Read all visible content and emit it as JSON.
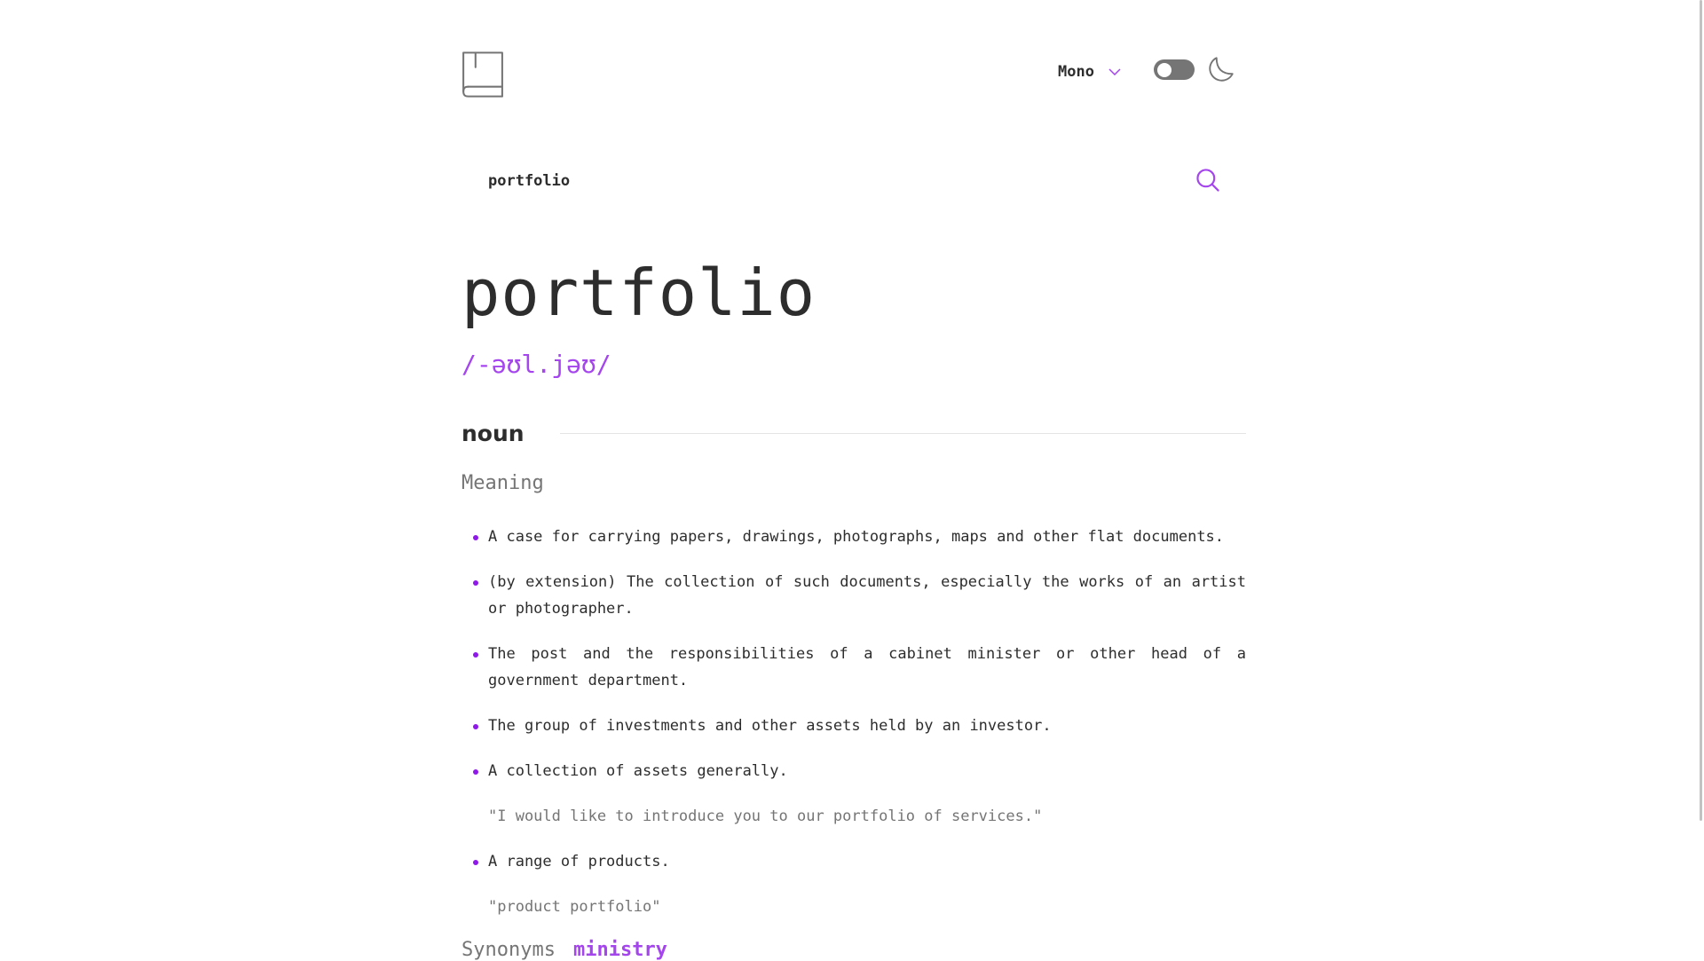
{
  "header": {
    "logo_icon": "book-icon",
    "font_selected": "Mono",
    "font_dropdown_icon": "chevron-down-icon",
    "theme_toggle_state": "off",
    "theme_icon": "moon-icon"
  },
  "search": {
    "value": "portfolio",
    "icon": "search-icon"
  },
  "entry": {
    "word": "portfolio",
    "phonetic": "/-əʊl.jəʊ/",
    "part_of_speech": "noun",
    "meaning_heading": "Meaning",
    "definitions": [
      {
        "text": "A case for carrying papers, drawings, photographs, maps and other flat documents.",
        "example": ""
      },
      {
        "text": "(by extension) The collection of such documents, especially the works of an artist or photographer.",
        "example": ""
      },
      {
        "text": "The post and the responsibilities of a cabinet minister or other head of a government department.",
        "example": ""
      },
      {
        "text": "The group of investments and other assets held by an investor.",
        "example": ""
      },
      {
        "text": "A collection of assets generally.",
        "example": "\"I would like to introduce you to our portfolio of services.\""
      },
      {
        "text": "A range of products.",
        "example": "\"product portfolio\""
      }
    ],
    "synonyms_label": "Synonyms",
    "synonyms": [
      "ministry"
    ]
  },
  "colors": {
    "accent": "#a445ed",
    "bullet": "#8f19e8",
    "text": "#2d2d2d",
    "muted": "#757575",
    "toggle_bg": "#757575"
  }
}
